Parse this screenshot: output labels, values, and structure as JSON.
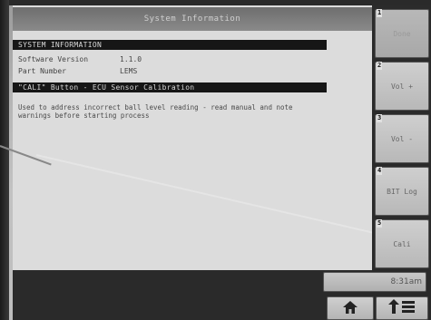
{
  "window": {
    "title": "System Information"
  },
  "sections": {
    "system_info": {
      "header": "SYSTEM INFORMATION"
    },
    "cali": {
      "header": "\"CALI\" Button - ECU Sensor Calibration"
    }
  },
  "info_rows": [
    {
      "label": "Software Version",
      "value": "1.1.0"
    },
    {
      "label": "Part Number",
      "value": "LEMS"
    }
  ],
  "description": "Used to address incorrect ball level reading - read manual and note warnings before starting process",
  "softkeys": [
    {
      "num": "1",
      "label": "Done",
      "enabled": false
    },
    {
      "num": "2",
      "label": "Vol +",
      "enabled": true
    },
    {
      "num": "3",
      "label": "Vol -",
      "enabled": true
    },
    {
      "num": "4",
      "label": "BIT Log",
      "enabled": true
    },
    {
      "num": "5",
      "label": "Cali",
      "enabled": true
    }
  ],
  "status": {
    "time": "8:31am"
  },
  "icons": {
    "home": "home-icon",
    "menu": "arrow-menu-icon"
  }
}
